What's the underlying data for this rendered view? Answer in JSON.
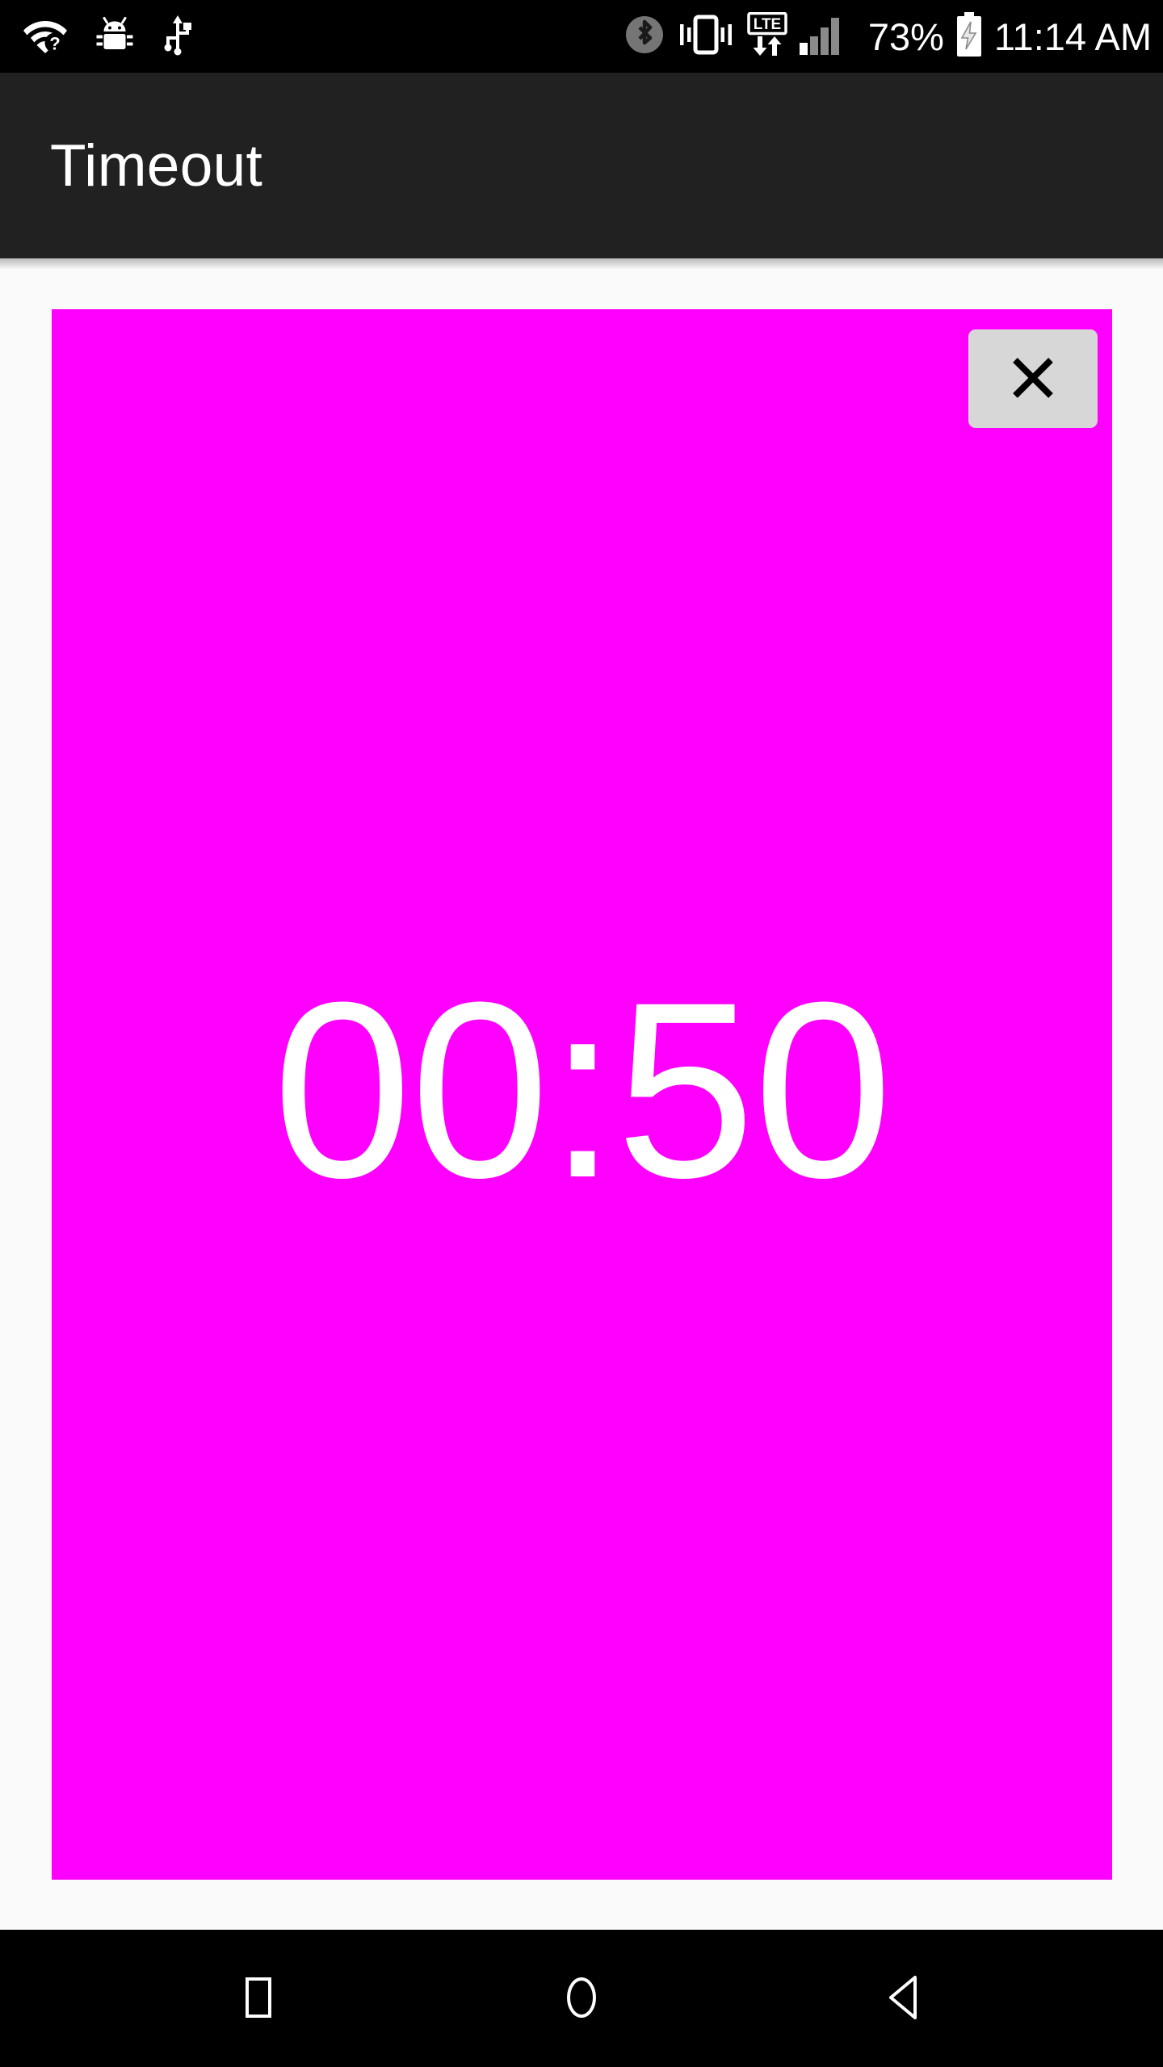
{
  "status_bar": {
    "background": "#000000",
    "left_icons": [
      {
        "name": "wifi-no-internet-icon",
        "label": "Wi-Fi no internet"
      },
      {
        "name": "android-debug-icon",
        "label": "USB debugging"
      },
      {
        "name": "usb-icon",
        "label": "USB connected"
      }
    ],
    "right_icons": [
      {
        "name": "bluetooth-icon",
        "label": "Bluetooth"
      },
      {
        "name": "vibrate-icon",
        "label": "Vibrate mode"
      },
      {
        "name": "lte-data-icon",
        "label": "LTE"
      },
      {
        "name": "signal-bars-icon",
        "label": "Signal strength"
      }
    ],
    "battery_percent": "73%",
    "battery_icon": "battery-charging-icon",
    "time": "11:14 AM"
  },
  "app_bar": {
    "title": "Timeout",
    "background": "#212121",
    "text_color": "#FFFFFF"
  },
  "timer": {
    "value": "00:50",
    "panel_color": "#FF00FF",
    "text_color": "#FFFFFF",
    "close_button": {
      "icon": "close-icon",
      "label": "×",
      "background": "#D7D7D7",
      "icon_color": "#000000"
    }
  },
  "nav_bar": {
    "background": "#000000",
    "buttons": [
      {
        "name": "recents-button",
        "icon": "square-icon",
        "label": "Recents"
      },
      {
        "name": "home-button",
        "icon": "circle-icon",
        "label": "Home"
      },
      {
        "name": "back-button",
        "icon": "triangle-left-icon",
        "label": "Back"
      }
    ]
  }
}
